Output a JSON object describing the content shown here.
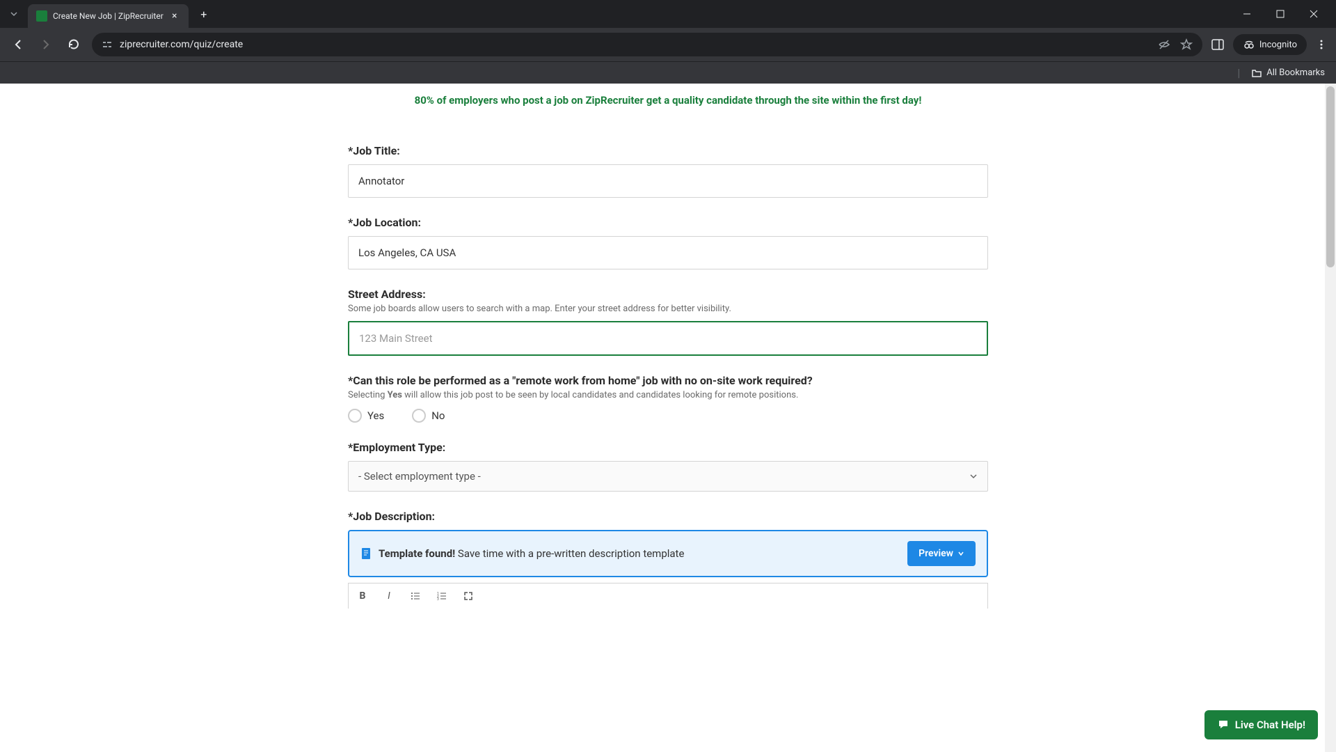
{
  "browser": {
    "tab_title": "Create New Job | ZipRecruiter",
    "url": "ziprecruiter.com/quiz/create",
    "incognito_label": "Incognito",
    "bookmarks_label": "All Bookmarks"
  },
  "banner": {
    "text": "80% of employers who post a job on ZipRecruiter get a quality candidate through the site within the first day!"
  },
  "form": {
    "job_title": {
      "label": "*Job Title:",
      "value": "Annotator"
    },
    "job_location": {
      "label": "*Job Location:",
      "value": "Los Angeles, CA USA"
    },
    "street_address": {
      "label": "Street Address:",
      "hint": "Some job boards allow users to search with a map. Enter your street address for better visibility.",
      "placeholder": "123 Main Street",
      "value": ""
    },
    "remote": {
      "label": "*Can this role be performed as a \"remote work from home\" job with no on-site work required?",
      "hint_prefix": "Selecting ",
      "hint_yes": "Yes",
      "hint_suffix": " will allow this job post to be seen by local candidates and candidates looking for remote positions.",
      "yes_label": "Yes",
      "no_label": "No"
    },
    "employment_type": {
      "label": "*Employment Type:",
      "selected": "- Select employment type -"
    },
    "job_description": {
      "label": "*Job Description:"
    },
    "template": {
      "found_label": "Template found!",
      "message": " Save time with a pre-written description template",
      "preview_label": "Preview"
    }
  },
  "chat": {
    "label": "Live Chat Help!"
  }
}
